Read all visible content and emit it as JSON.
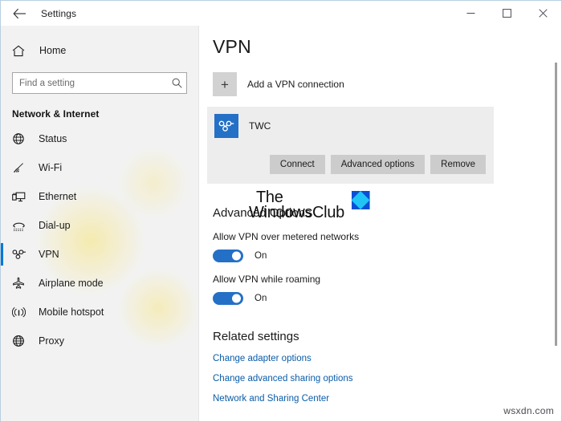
{
  "titlebar": {
    "back_icon": "back-arrow-icon",
    "title": "Settings",
    "minimize_label": "—",
    "maximize_label": "□",
    "close_label": "✕"
  },
  "sidebar": {
    "home": {
      "label": "Home",
      "icon": "home-icon"
    },
    "search": {
      "value": "",
      "placeholder": "Find a setting",
      "icon": "search-icon"
    },
    "group_title": "Network & Internet",
    "items": [
      {
        "label": "Status",
        "icon": "status-globe-icon",
        "selected": false
      },
      {
        "label": "Wi-Fi",
        "icon": "wifi-icon",
        "selected": false
      },
      {
        "label": "Ethernet",
        "icon": "ethernet-icon",
        "selected": false
      },
      {
        "label": "Dial-up",
        "icon": "dialup-phone-icon",
        "selected": false
      },
      {
        "label": "VPN",
        "icon": "vpn-knot-icon",
        "selected": true
      },
      {
        "label": "Airplane mode",
        "icon": "airplane-icon",
        "selected": false
      },
      {
        "label": "Mobile hotspot",
        "icon": "hotspot-icon",
        "selected": false
      },
      {
        "label": "Proxy",
        "icon": "proxy-globe-icon",
        "selected": false
      }
    ]
  },
  "main": {
    "page_title": "VPN",
    "add_connection": {
      "plus_label": "+",
      "label": "Add a VPN connection"
    },
    "connection": {
      "name": "TWC",
      "icon": "vpn-knot-icon",
      "tile_color": "#2470c6",
      "buttons": [
        {
          "label": "Connect"
        },
        {
          "label": "Advanced options"
        },
        {
          "label": "Remove"
        }
      ]
    },
    "advanced": {
      "heading": "Advanced Options",
      "settings": [
        {
          "label": "Allow VPN over metered networks",
          "state": "On",
          "enabled": true
        },
        {
          "label": "Allow VPN while roaming",
          "state": "On",
          "enabled": true
        }
      ]
    },
    "related": {
      "heading": "Related settings",
      "links": [
        {
          "label": "Change adapter options"
        },
        {
          "label": "Change advanced sharing options"
        },
        {
          "label": "Network and Sharing Center"
        }
      ]
    }
  },
  "watermarks": {
    "brand_line1": "The",
    "brand_line2": "WindowsClub",
    "brand_logo": "windowsclub-logo-icon",
    "site": "wsxdn.com"
  },
  "colors": {
    "accent": "#0078d7",
    "toggle_on": "#2470c6",
    "link": "#0a5ca8",
    "sidebar_bg": "#f2f2f2",
    "card_bg": "#ededed",
    "button_bg": "#cccccc"
  }
}
